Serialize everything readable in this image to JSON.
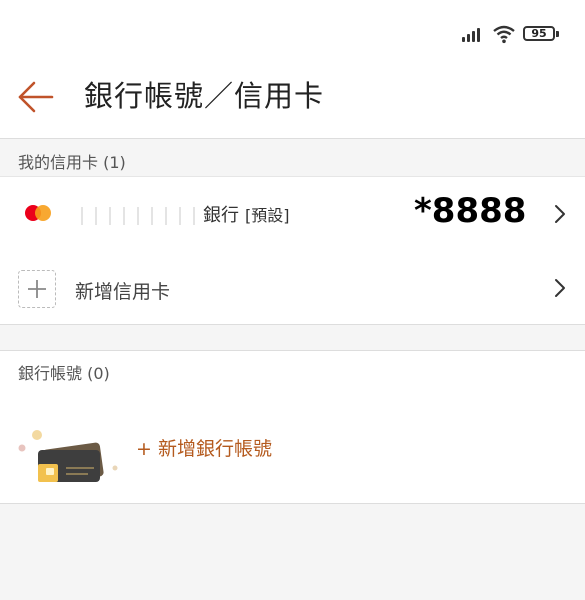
{
  "status_bar": {
    "battery_level": "95",
    "icons": [
      "signal-icon",
      "wifi-icon",
      "battery-icon"
    ]
  },
  "header": {
    "title": "銀行帳號／信用卡",
    "back_icon": "arrow-left-icon",
    "accent_color": "#c0532a"
  },
  "credit_cards": {
    "section_label": "我的信用卡 (1)",
    "items": [
      {
        "brand_icon": "mastercard-icon",
        "bank_name_visible": "銀行",
        "default_tag": "[預設]",
        "card_number": "*8888"
      }
    ],
    "add_label": "新增信用卡"
  },
  "bank_accounts": {
    "section_label": "銀行帳號 (0)",
    "add_label": "+ 新增銀行帳號"
  }
}
